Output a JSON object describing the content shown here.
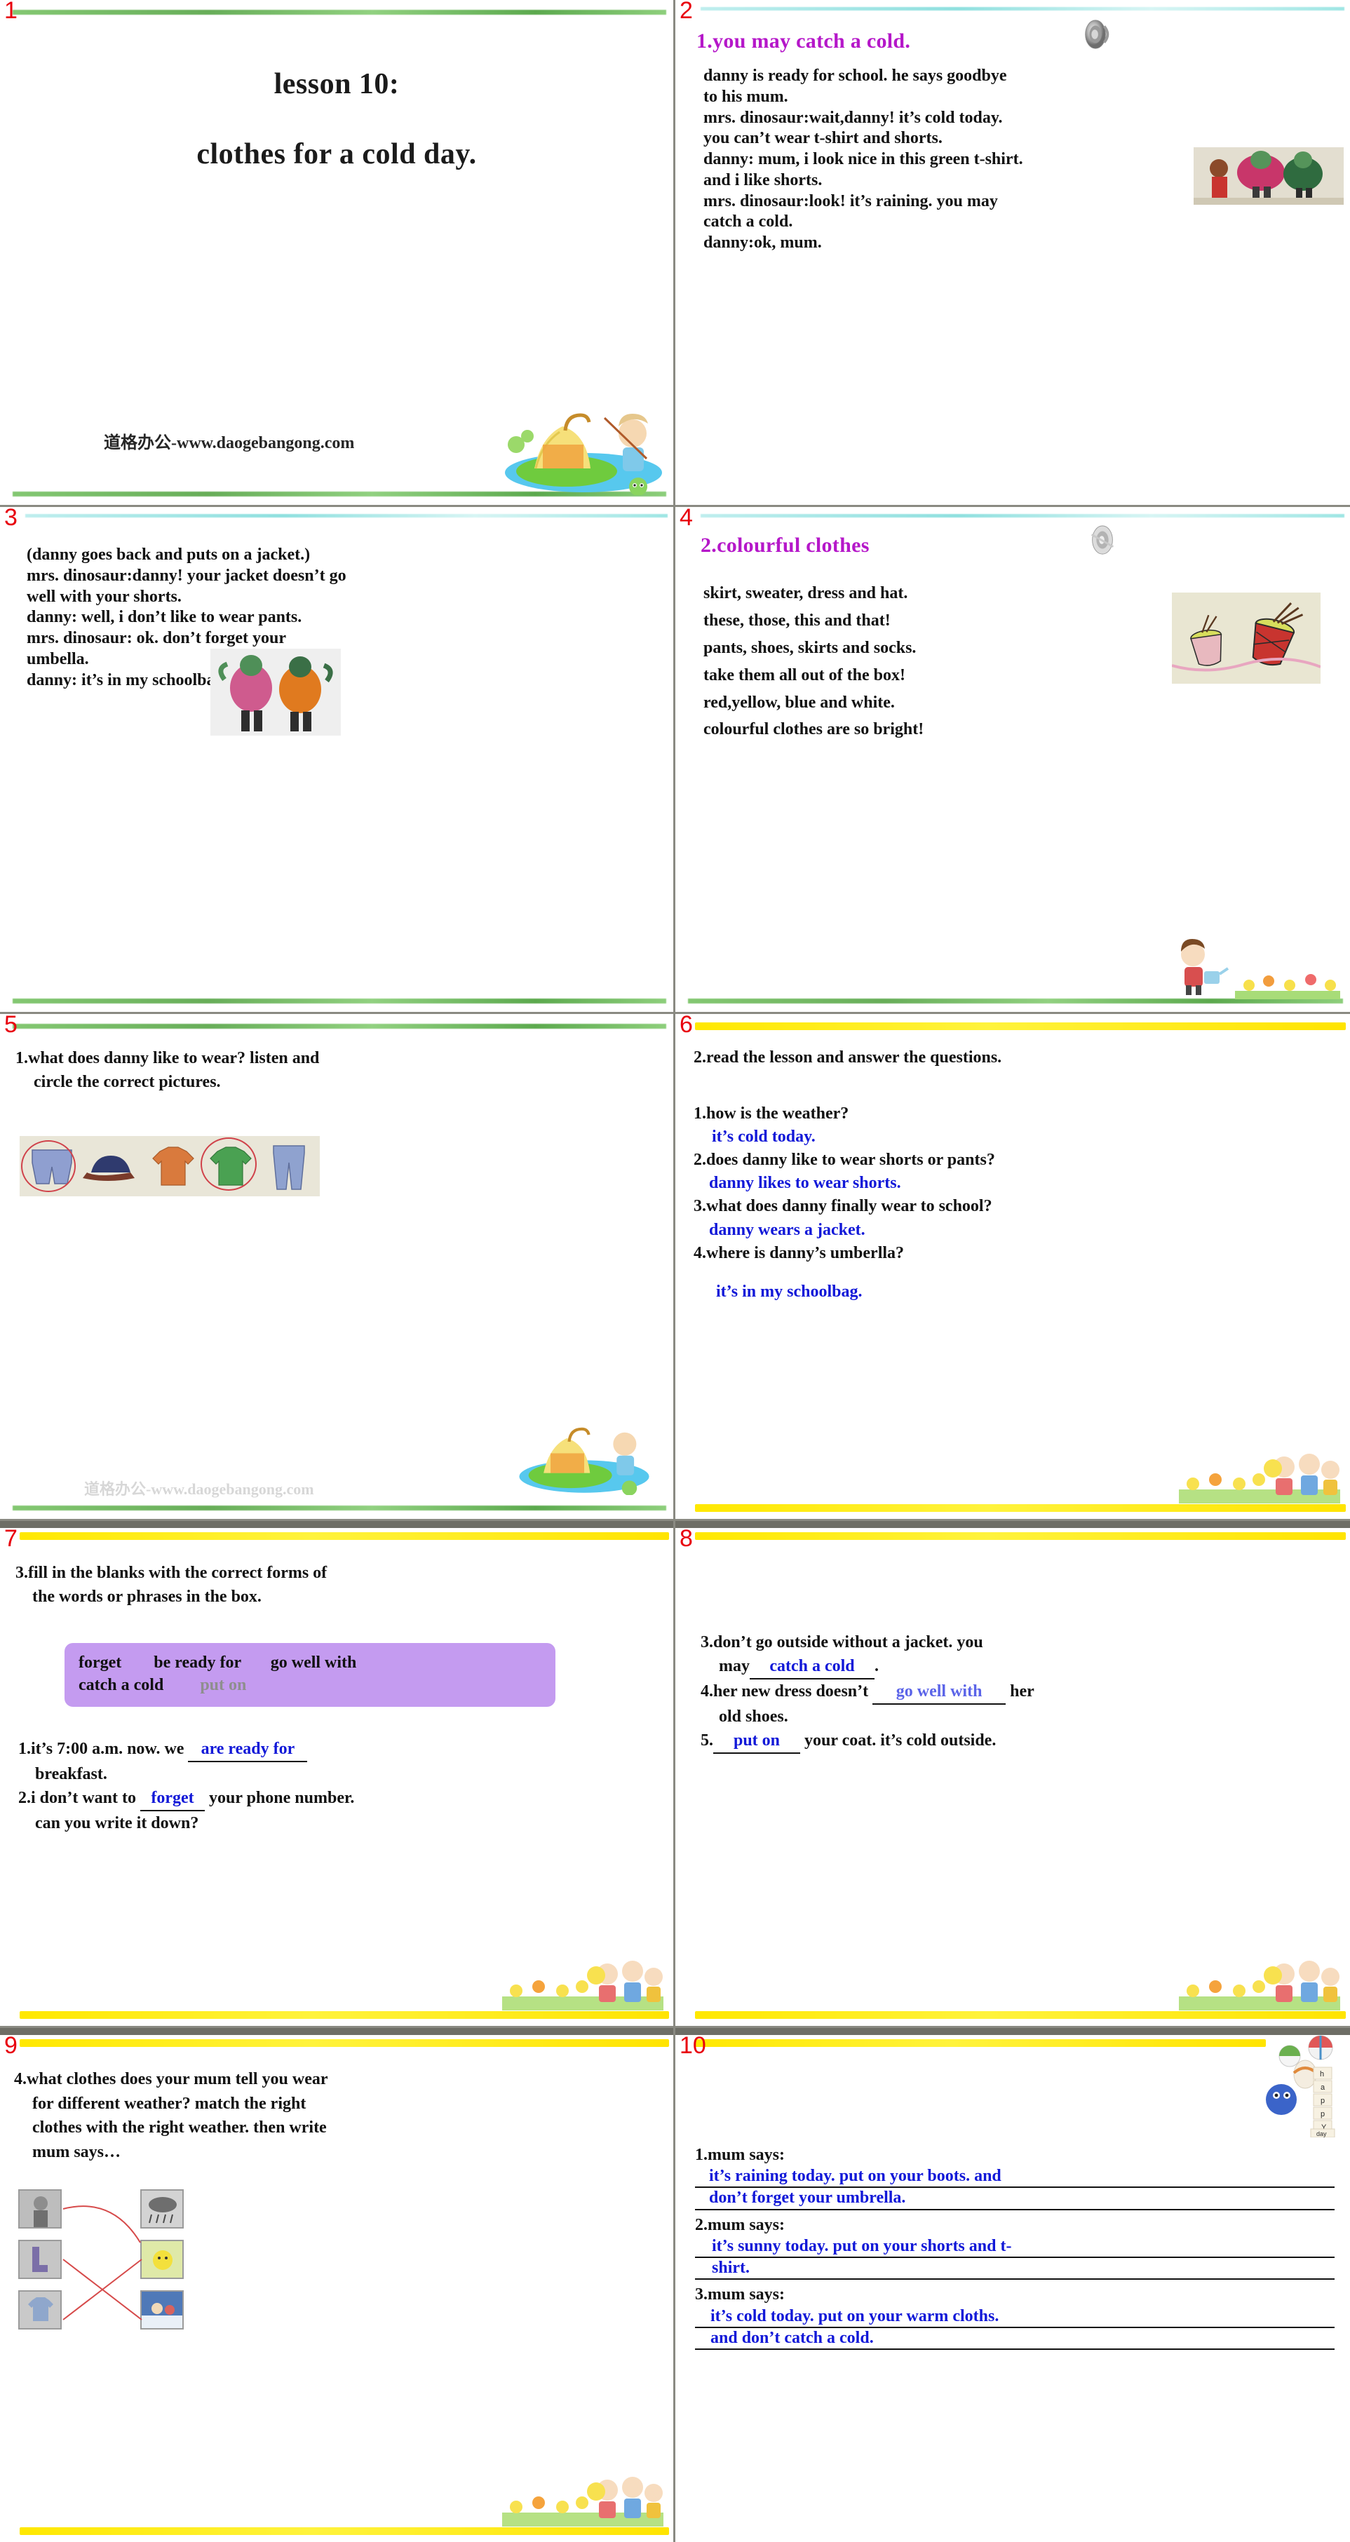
{
  "deck": {
    "watermark": "道格办公-www.daogebangong.com"
  },
  "slides": [
    {
      "number": "1",
      "title_line1": "lesson 10:",
      "title_line2": "clothes for a cold day."
    },
    {
      "number": "2",
      "heading": "1.you may catch a cold.",
      "lines": [
        "danny is ready for school. he says goodbye",
        "to his mum.",
        "mrs. dinosaur:wait,danny! it’s cold today.",
        "you can’t wear t-shirt and shorts.",
        "danny: mum, i look nice in this green t-shirt.",
        "and i like shorts.",
        "mrs. dinosaur:look! it’s raining. you may",
        "catch a cold.",
        "danny:ok, mum."
      ],
      "speaker_icon": "speaker-icon"
    },
    {
      "number": "3",
      "lines": [
        "(danny goes back and puts on a jacket.)",
        "mrs. dinosaur:danny! your jacket doesn’t go",
        "well with your shorts.",
        "danny: well, i don’t like to wear pants.",
        "mrs. dinosaur: ok. don’t forget your",
        "umbella.",
        "danny: it’s in my schoolbag. bye,mom."
      ]
    },
    {
      "number": "4",
      "heading": "2.colourful clothes",
      "lines": [
        "skirt, sweater, dress and hat.",
        "these, those, this and that!",
        "pants, shoes, skirts and socks.",
        "take them all out of the box!",
        "red,yellow, blue and white.",
        "colourful clothes are so bright!"
      ],
      "speaker_icon": "speaker-icon"
    },
    {
      "number": "5",
      "task_line1": "1.what does danny like to wear? listen and",
      "task_line2": "circle the correct pictures.",
      "picture_items": [
        "shorts",
        "cap",
        "t-shirt-orange",
        "t-shirt-green",
        "pants"
      ],
      "circled_items": [
        "shorts",
        "t-shirt-green"
      ]
    },
    {
      "number": "6",
      "task": "2.read the lesson and answer the questions.",
      "qa": [
        {
          "q": "1.how is the weather?",
          "a": "it’s cold today."
        },
        {
          "q": "2.does danny like to wear shorts or pants?",
          "a": "danny likes to wear shorts."
        },
        {
          "q": "3.what does danny finally wear to school?",
          "a": "danny wears a jacket."
        },
        {
          "q": "4.where is danny’s umberlla?",
          "a": "it’s in my schoolbag."
        }
      ]
    },
    {
      "number": "7",
      "task_line1": "3.fill in the blanks with the correct forms of",
      "task_line2": "the words or phrases in the box.",
      "wordbox_row1": [
        "forget",
        "be ready for",
        "go well with"
      ],
      "wordbox_row2": [
        "catch a cold",
        "put on"
      ],
      "items": [
        {
          "pre": "1.it’s 7:00 a.m. now. we",
          "answer": "are ready for",
          "post": "",
          "cont": "breakfast."
        },
        {
          "pre": "2.i don’t want to",
          "answer": "forget",
          "post": "your phone number.",
          "cont": "can you write it down?"
        }
      ]
    },
    {
      "number": "8",
      "items": [
        {
          "pre": "3.don’t go outside without a jacket. you",
          "cont_pre": "may",
          "answer": "catch a cold",
          "post": "."
        },
        {
          "pre": "4.her new dress doesn’t",
          "answer": "go well with",
          "post": "her",
          "cont": "old shoes."
        },
        {
          "pre": "5.",
          "answer": "put on",
          "post": "your coat. it’s cold outside."
        }
      ]
    },
    {
      "number": "9",
      "task_lines": [
        "4.what clothes does your mum tell you wear",
        "for different weather? match the right",
        "clothes with the right weather. then write",
        "mum says…"
      ],
      "left_items": [
        "girl-raincoat",
        "boots",
        "t-shirt"
      ],
      "right_items": [
        "rain-cloud",
        "sun",
        "snow-scene"
      ]
    },
    {
      "number": "10",
      "entries": [
        {
          "label": "1.mum says:",
          "answer_line1": "it’s raining today. put on your boots. and",
          "answer_line2": "don’t forget your umbrella."
        },
        {
          "label": "2.mum says:",
          "answer_line1": "it’s sunny today. put on your shorts and t-",
          "answer_line2": "shirt."
        },
        {
          "label": "3.mum says:",
          "answer_line1": "it’s cold today. put on your warm cloths.",
          "answer_line2": "and don’t catch a cold."
        }
      ],
      "corner_art": "happy-day-balloons"
    }
  ],
  "colors": {
    "slide_number": "#e8000d",
    "heading_purple": "#b517c9",
    "answer_blue": "#1118d8",
    "wordbox_purple": "#c49bf0",
    "rule_green": "#4da03c",
    "rule_yellow": "#ffe800",
    "rule_aqua": "#8fe0df"
  }
}
